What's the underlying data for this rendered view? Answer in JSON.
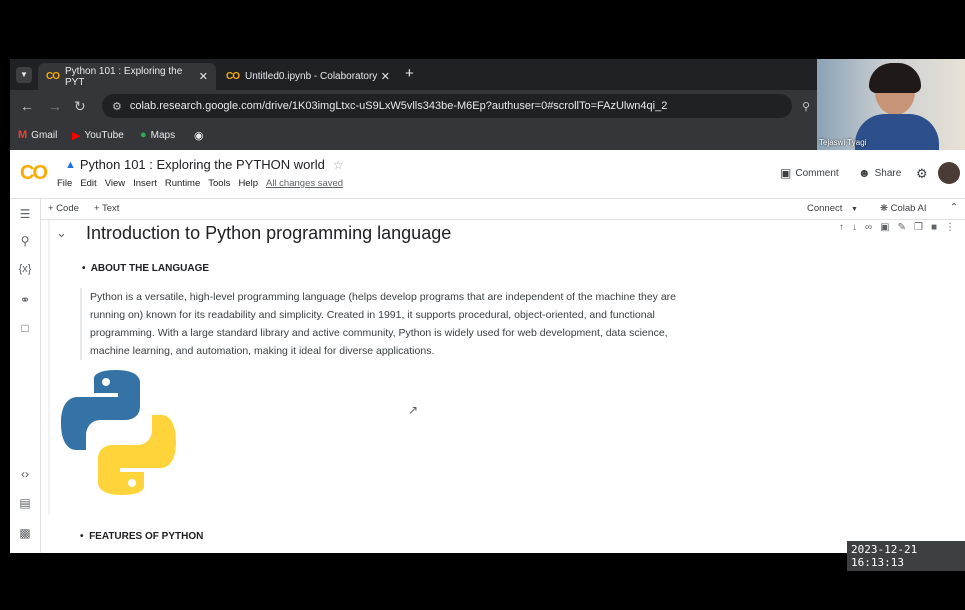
{
  "browser": {
    "tabs": [
      {
        "label": "Python 101 : Exploring the PYT",
        "icon": "CO"
      },
      {
        "label": "Untitled0.ipynb - Colaboratory",
        "icon": "CO"
      }
    ],
    "new_tab": "+",
    "url": "colab.research.google.com/drive/1K03imgLtxc-uS9LxW5vlls343be-M6Ep?authuser=0#scrollTo=FAzUlwn4qi_2",
    "bookmarks": [
      "Gmail",
      "YouTube",
      "Maps"
    ]
  },
  "colab": {
    "logo": "CO",
    "title": "Python 101 : Exploring the PYTHON world",
    "menu": [
      "File",
      "Edit",
      "View",
      "Insert",
      "Runtime",
      "Tools",
      "Help"
    ],
    "saved_status": "All changes saved",
    "comment": "Comment",
    "share": "Share",
    "add_code": "+ Code",
    "add_text": "+ Text",
    "connect": "Connect",
    "colab_ai": "Colab AI"
  },
  "notebook": {
    "section_title": "Introduction to Python programming language",
    "heading1": "ABOUT THE LANGUAGE",
    "paragraph_lines": [
      "Python is a versatile, high-level programming language (helps develop programs that are independent of the machine they are",
      "running on) known for its readability and simplicity. Created in 1991, it supports procedural, object-oriented, and functional",
      "programming. With a large standard library and active community, Python is widely used for web development, data science,",
      "machine learning, and automation, making it ideal for diverse applications."
    ],
    "heading2": "FEATURES OF PYTHON"
  },
  "webcam": {
    "name": "Tejaswi Tyagi"
  },
  "timestamp": "2023-12-21 16:13:13",
  "colors": {
    "accent": "#f9ab00",
    "chrome_dark": "#202124",
    "chrome_mid": "#35363a"
  }
}
